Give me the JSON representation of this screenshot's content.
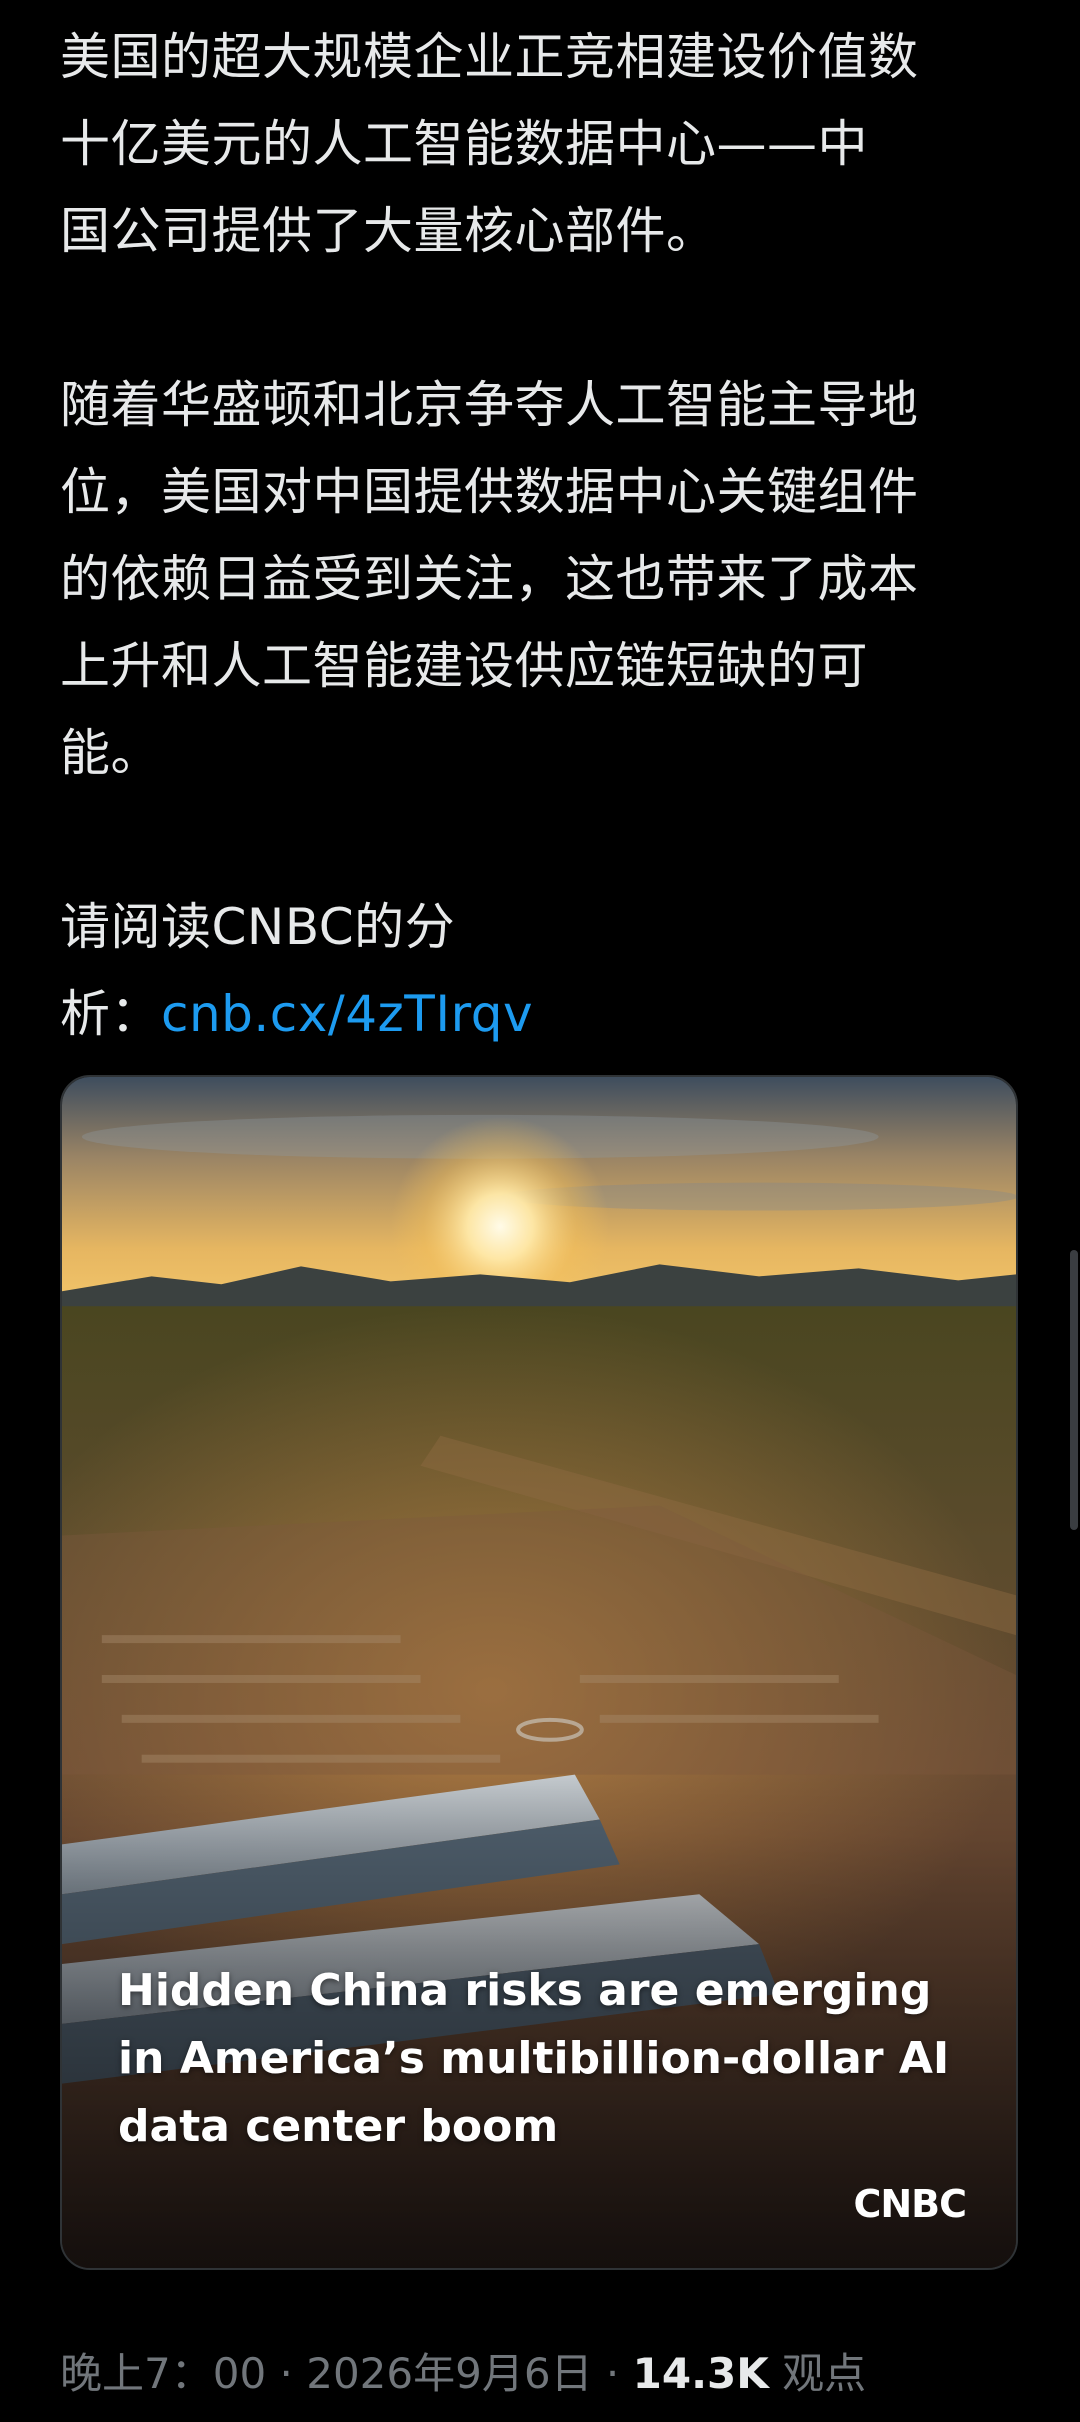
{
  "tweet": {
    "paragraphs": [
      [
        "美国的超大规模企业正竞相建设价值数",
        "十亿美元的人工智能数据中心——中",
        "国公司提供了大量核心部件。"
      ],
      [
        "随着华盛顿和北京争夺人工智能主导地",
        "位，美国对中国提供数据中心关键组件",
        "的依赖日益受到关注，这也带来了成本",
        "上升和人工智能建设供应链短缺的可",
        "能。"
      ]
    ],
    "read_line1": "请阅读CNBC的分",
    "read_line2_prefix": "析：",
    "link_text": "cnb.cx/4zTIrqv"
  },
  "card": {
    "headline_lines": [
      "Hidden China risks are emerging",
      "in America’s multibillion-dollar AI",
      "data center boom"
    ],
    "brand": "CNBC"
  },
  "meta": {
    "time": "晚上7：00",
    "separator1": " · ",
    "date": "2026年9月6日",
    "separator2": " · ",
    "views_count": "14.3K",
    "views_label": " 观点"
  },
  "colors": {
    "background": "#000000",
    "text": "#e7e9ea",
    "link": "#1d9bf0",
    "muted": "#71767b"
  }
}
